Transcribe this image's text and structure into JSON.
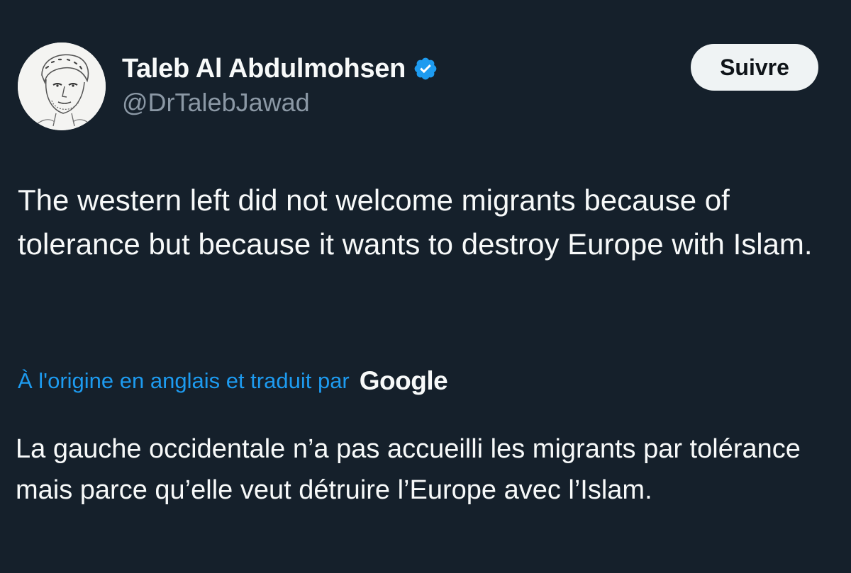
{
  "author": {
    "display_name": "Taleb Al Abdulmohsen",
    "handle": "@DrTalebJawad",
    "verified_icon": "verified-badge-icon",
    "avatar": "line-drawing portrait"
  },
  "actions": {
    "follow_label": "Suivre"
  },
  "tweet": {
    "text": "The western left did not welcome migrants because of tolerance but because it wants to destroy Europe with Islam."
  },
  "translation": {
    "attribution": "À l'origine en anglais et traduit par",
    "provider": "Google",
    "text": "La gauche occidentale n’a pas accueilli les migrants par tolérance mais parce qu’elle veut détruire l’Europe avec l’Islam."
  },
  "colors": {
    "background": "#15202b",
    "text": "#f7f9f9",
    "secondary_text": "#8b98a5",
    "link": "#1d9bf0",
    "verified": "#1d9bf0",
    "button_bg": "#eff3f4"
  }
}
